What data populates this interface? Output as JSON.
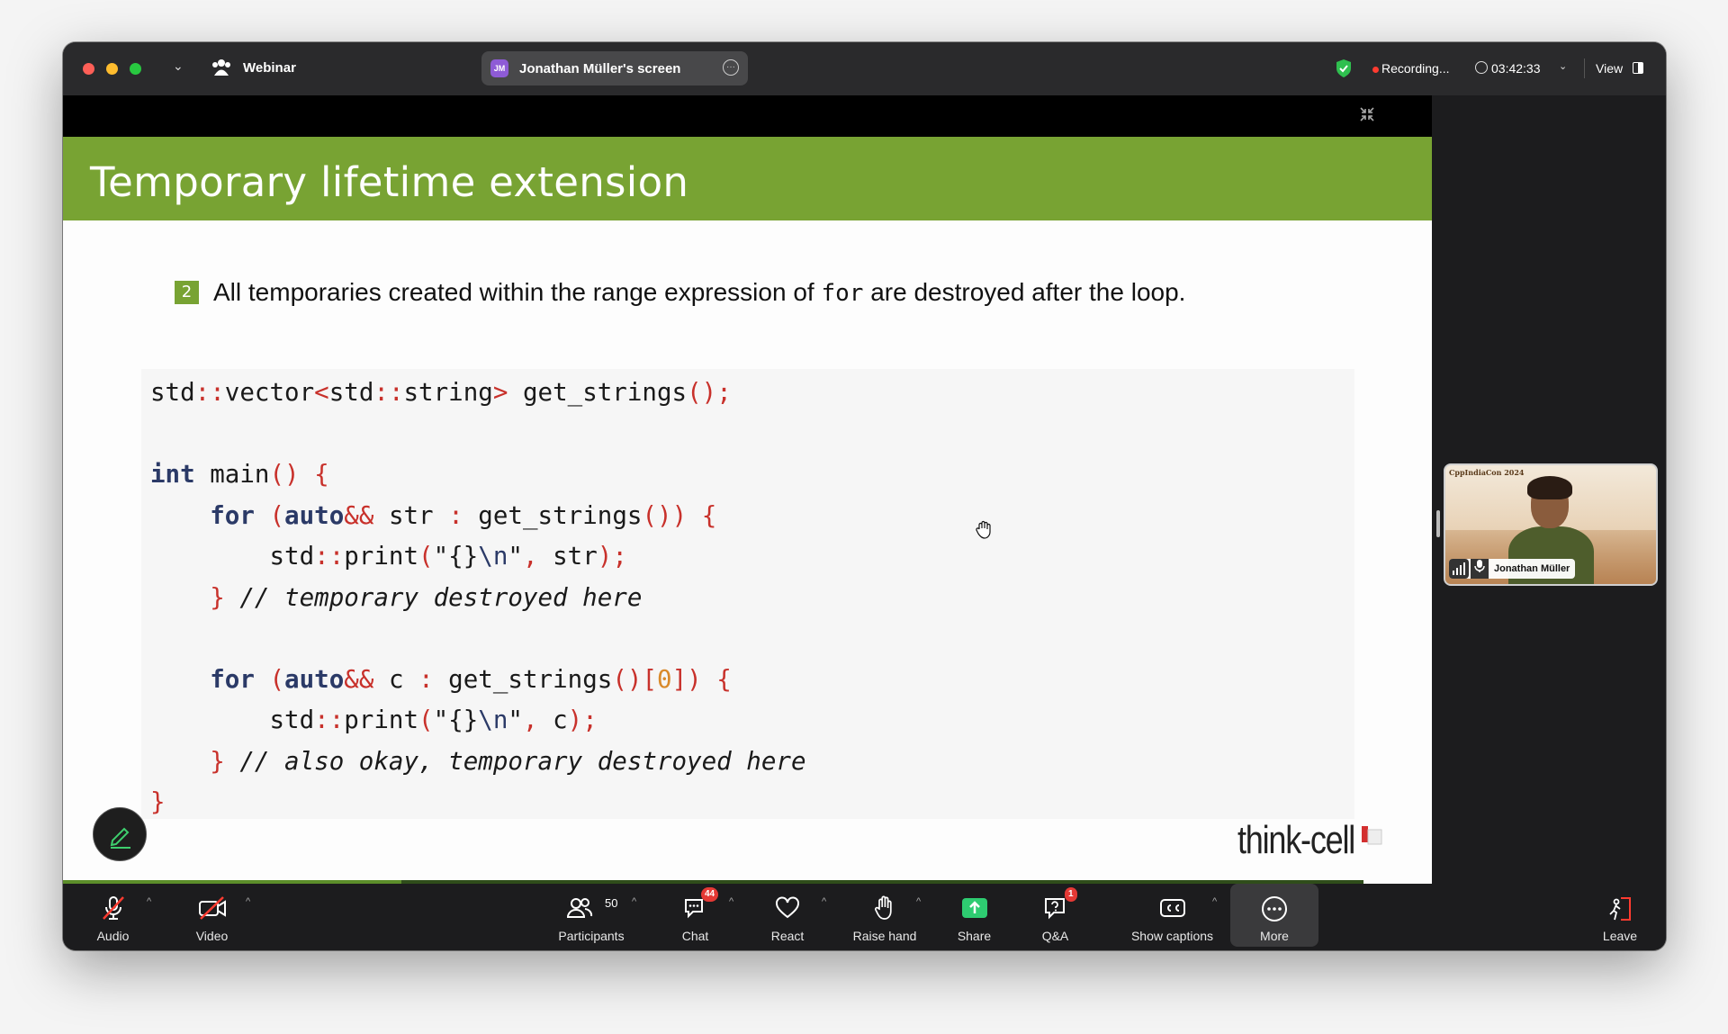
{
  "titlebar": {
    "meeting_type": "Webinar",
    "share_label": "Jonathan Müller's screen",
    "share_avatar_initials": "JM",
    "recording_label": "Recording...",
    "timer": "03:42:33",
    "view_label": "View"
  },
  "slide": {
    "title": "Temporary lifetime extension",
    "bullet_number": "2",
    "bullet_text_before": "All temporaries created within the range expression of ",
    "bullet_code": "for",
    "bullet_text_after": " are destroyed after the loop.",
    "code_lines": [
      "std::vector<std::string> get_strings();",
      "",
      "int main() {",
      "    for (auto&& str : get_strings()) {",
      "        std::print(\"{}\\n\", str);",
      "    } // temporary destroyed here",
      "",
      "    for (auto&& c : get_strings()[0]) {",
      "        std::print(\"{}\\n\", c);",
      "    } // also okay, temporary destroyed here",
      "}"
    ],
    "brand": "think-cell",
    "progress_fraction": 0.26
  },
  "participant_video": {
    "name": "Jonathan Müller",
    "conference": "CppIndiaCon 2024"
  },
  "toolbar": {
    "audio": "Audio",
    "video": "Video",
    "participants": "Participants",
    "participants_count": "50",
    "chat": "Chat",
    "chat_badge": "44",
    "react": "React",
    "raise_hand": "Raise hand",
    "share": "Share",
    "qa": "Q&A",
    "qa_badge": "1",
    "captions": "Show captions",
    "more": "More",
    "leave": "Leave"
  },
  "colors": {
    "slide_green": "#78a333",
    "recording_red": "#ff3b30",
    "share_green": "#2ecc71",
    "badge_red": "#e53935"
  }
}
